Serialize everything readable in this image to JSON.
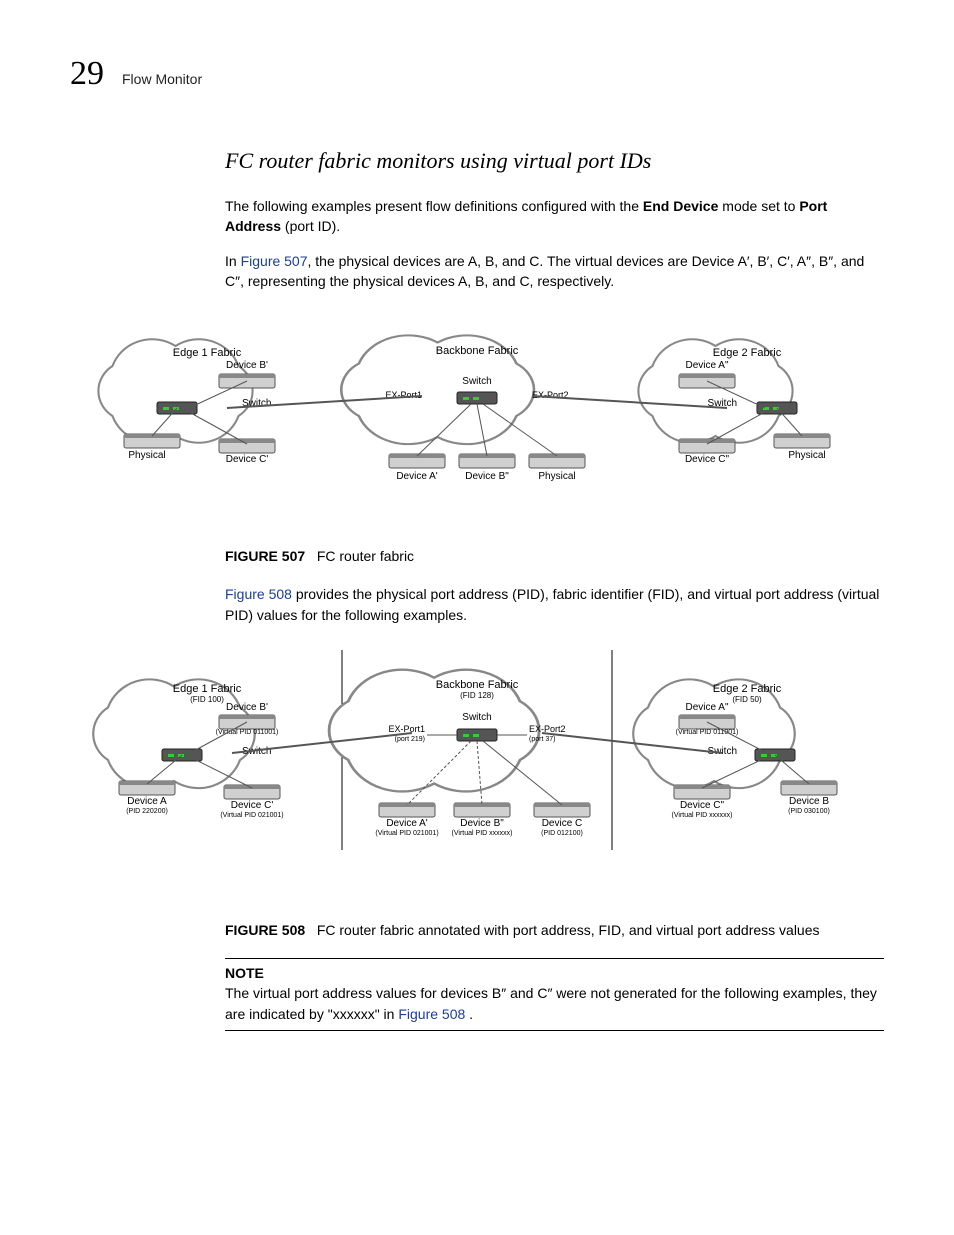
{
  "header": {
    "chapter_number": "29",
    "running_title": "Flow Monitor"
  },
  "section": {
    "title": "FC router fabric monitors using virtual port IDs"
  },
  "para1": {
    "t1": "The following examples present flow definitions configured with the ",
    "b1": "End Device",
    "t2": " mode set to ",
    "b2": "Port Address",
    "t3": " (port ID)."
  },
  "para2": {
    "t1": "In ",
    "link": "Figure 507",
    "t2": ", the physical devices are A, B, and C. The virtual devices are Device A′, B′, C′, A″, B″, and C″, representing the physical devices A, B, and C, respectively."
  },
  "fig507": {
    "num": "FIGURE 507",
    "cap": "FC router fabric",
    "diagram": {
      "edge1": {
        "title": "Edge 1 Fabric",
        "deviceB": "Device B'",
        "deviceC": "Device C'",
        "switch": "Switch",
        "physical": "Physical"
      },
      "backbone": {
        "title": "Backbone Fabric",
        "switch": "Switch",
        "exp1": "EX-Port1",
        "exp2": "EX-Port2",
        "deviceA": "Device A'",
        "deviceB": "Device B\"",
        "physical": "Physical"
      },
      "edge2": {
        "title": "Edge 2 Fabric",
        "deviceA": "Device A\"",
        "deviceC": "Device C\"",
        "switch": "Switch",
        "physical": "Physical"
      }
    }
  },
  "para3": {
    "link": "Figure 508",
    "t2": " provides the physical port address (PID), fabric identifier (FID), and virtual port address (virtual PID) values for the following examples."
  },
  "fig508": {
    "num": "FIGURE 508",
    "cap": "FC router fabric annotated with port address, FID, and virtual port address values",
    "diagram": {
      "edge1": {
        "title": "Edge 1 Fabric",
        "fid": "(FID 100)",
        "deviceB": "Device B'",
        "deviceB_sub": "(Virtual PID 011001)",
        "switch": "Switch",
        "deviceA": "Device A",
        "deviceA_sub": "(PID 220200)",
        "deviceC": "Device C'",
        "deviceC_sub": "(Virtual PID 021001)"
      },
      "backbone": {
        "title": "Backbone Fabric",
        "fid": "(FID 128)",
        "switch": "Switch",
        "exp1": "EX-Port1",
        "exp1_sub": "(port 219)",
        "exp2": "EX-Port2",
        "exp2_sub": "(port 37)",
        "deviceA": "Device A'",
        "deviceA_sub": "(Virtual PID 021001)",
        "deviceB": "Device B\"",
        "deviceB_sub": "(Virtual PID xxxxxx)",
        "deviceC": "Device C",
        "deviceC_sub": "(PID 012100)"
      },
      "edge2": {
        "title": "Edge 2 Fabric",
        "fid": "(FID 50)",
        "deviceA": "Device A\"",
        "deviceA_sub": "(Virtual PID 011001)",
        "switch": "Switch",
        "deviceB": "Device B",
        "deviceB_sub": "(PID 030100)",
        "deviceC": "Device C\"",
        "deviceC_sub": "(Virtual PID xxxxxx)"
      }
    }
  },
  "note": {
    "head": "NOTE",
    "t1": "The virtual port address values for devices B″ and C″ were not generated for the following examples, they are indicated by \"xxxxxx\" in ",
    "link": "Figure 508",
    "t2": " ."
  }
}
